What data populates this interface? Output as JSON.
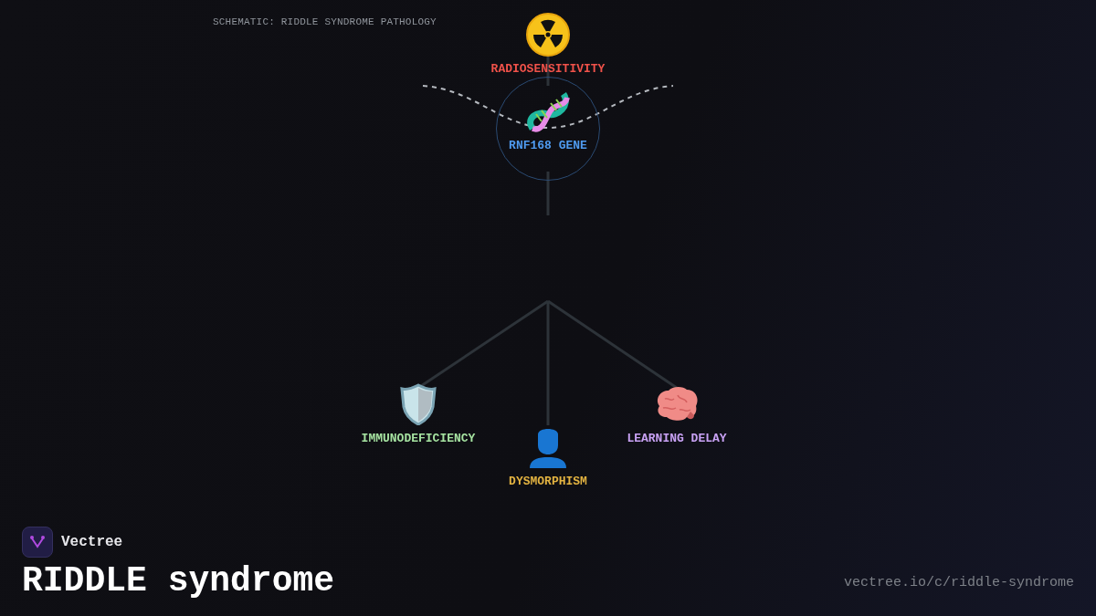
{
  "caption": "SCHEMATIC: RIDDLE SYNDROME PATHOLOGY",
  "nodes": [
    {
      "kind": "radiation",
      "label": "RADIOSENSITIVITY",
      "color": "#f0524a",
      "ring": false
    },
    {
      "kind": "dna",
      "label": "RNF168 GENE",
      "color": "#4f9bf0",
      "ring": true
    },
    {
      "kind": "shield",
      "label": "IMMUNODEFICIENCY",
      "color": "#a6e3a1",
      "ring": false
    },
    {
      "kind": "person",
      "label": "DYSMORPHISM",
      "color": "#e3b341",
      "ring": false
    },
    {
      "kind": "brain",
      "label": "LEARNING DELAY",
      "color": "#c9a2f5",
      "ring": false
    }
  ],
  "brand": {
    "name": "Vectree"
  },
  "title": "RIDDLE syndrome",
  "url": "vectree.io/c/riddle-syndrome"
}
